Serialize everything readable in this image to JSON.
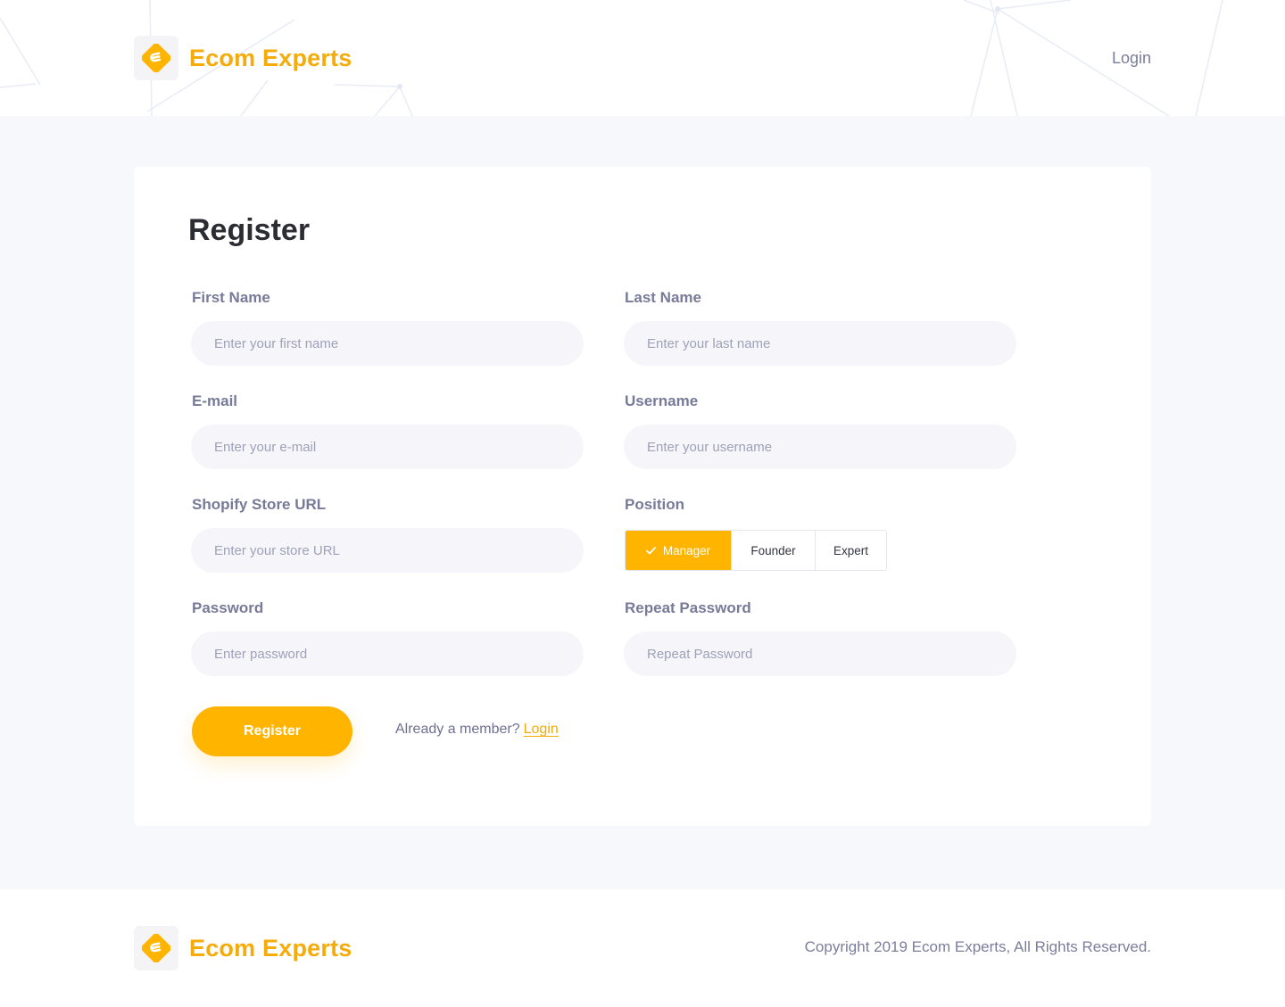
{
  "brand": {
    "name": "Ecom Experts",
    "accent_color": "#f5ab0a",
    "logo_icon": "ecom-experts-logo-icon"
  },
  "header": {
    "login_label": "Login"
  },
  "form": {
    "title": "Register",
    "first_name": {
      "label": "First Name",
      "placeholder": "Enter your first name",
      "value": ""
    },
    "last_name": {
      "label": "Last Name",
      "placeholder": "Enter your last name",
      "value": ""
    },
    "email": {
      "label": "E-mail",
      "placeholder": "Enter your e-mail",
      "value": ""
    },
    "username": {
      "label": "Username",
      "placeholder": "Enter your username",
      "value": ""
    },
    "store_url": {
      "label": "Shopify Store URL",
      "placeholder": "Enter your store URL",
      "value": ""
    },
    "position": {
      "label": "Position",
      "options": [
        "Manager",
        "Founder",
        "Expert"
      ],
      "selected": "Manager"
    },
    "password": {
      "label": "Password",
      "placeholder": "Enter password",
      "value": ""
    },
    "repeat_password": {
      "label": "Repeat Password",
      "placeholder": "Repeat Password",
      "value": ""
    },
    "submit_label": "Register",
    "member_prompt": "Already a member?",
    "member_link": "Login"
  },
  "footer": {
    "brand_name": "Ecom Experts",
    "copyright": "Copyright 2019 Ecom Experts, All Rights Reserved."
  }
}
